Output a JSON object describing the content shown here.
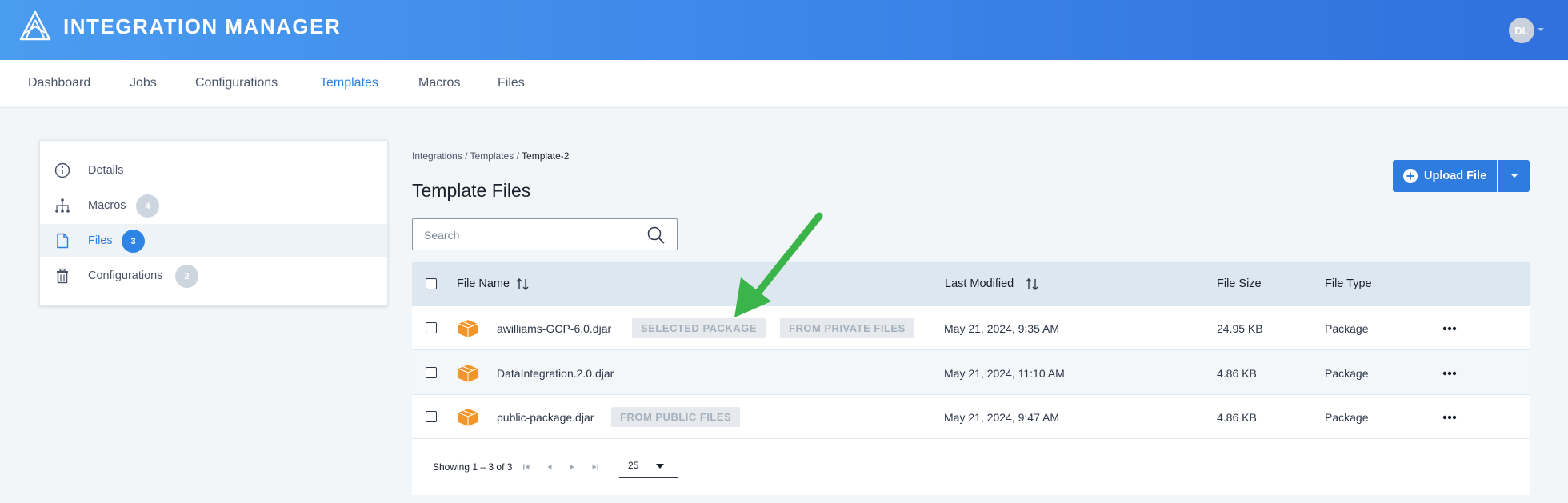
{
  "app": {
    "title": "INTEGRATION MANAGER",
    "user_initials": "DL",
    "accent_color": "#2f80e0"
  },
  "nav": {
    "items": [
      {
        "label": "Dashboard"
      },
      {
        "label": "Jobs"
      },
      {
        "label": "Configurations"
      },
      {
        "label": "Templates",
        "active": true
      },
      {
        "label": "Macros"
      },
      {
        "label": "Files"
      }
    ]
  },
  "sidebar": {
    "items": [
      {
        "label": "Details",
        "icon": "info-icon"
      },
      {
        "label": "Macros",
        "icon": "hierarchy-icon",
        "badge": "4"
      },
      {
        "label": "Files",
        "icon": "file-icon",
        "badge": "3",
        "active": true
      },
      {
        "label": "Configurations",
        "icon": "trash-icon",
        "badge": "2"
      }
    ]
  },
  "breadcrumb": {
    "items": [
      "Integrations",
      "Templates",
      "Template-2"
    ],
    "separator": "/"
  },
  "page": {
    "title": "Template Files"
  },
  "search": {
    "placeholder": "Search",
    "value": ""
  },
  "toolbar": {
    "upload_label": "Upload File"
  },
  "table": {
    "columns": [
      "File Name",
      "Last Modified",
      "File Size",
      "File Type"
    ],
    "rows": [
      {
        "name": "awilliams-GCP-6.0.djar",
        "tags": [
          "SELECTED PACKAGE",
          "FROM PRIVATE FILES"
        ],
        "modified": "May 21, 2024, 9:35 AM",
        "size": "24.95 KB",
        "type": "Package"
      },
      {
        "name": "DataIntegration.2.0.djar",
        "tags": [],
        "modified": "May 21, 2024, 11:10 AM",
        "size": "4.86 KB",
        "type": "Package"
      },
      {
        "name": "public-package.djar",
        "tags": [
          "FROM PUBLIC FILES"
        ],
        "modified": "May 21, 2024, 9:47 AM",
        "size": "4.86 KB",
        "type": "Package"
      }
    ]
  },
  "pagination": {
    "showing": "Showing 1 – 3 of 3",
    "per_page": "25"
  },
  "annotation": {
    "arrow_color": "#3bb54a"
  }
}
